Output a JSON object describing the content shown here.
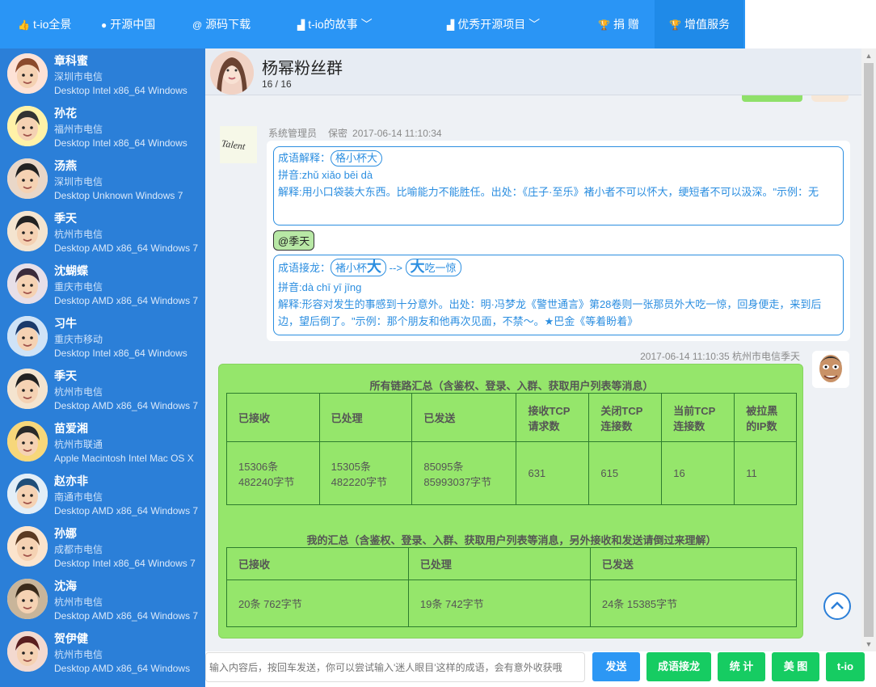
{
  "nav": {
    "items": [
      {
        "icon": "thumb-icon",
        "label": "t-io全景"
      },
      {
        "icon": "github-icon",
        "label": "开源中国"
      },
      {
        "icon": "at-icon",
        "label": "源码下载"
      },
      {
        "icon": "bar-chart-icon",
        "label": "t-io的故事"
      },
      {
        "icon": "bar-chart-icon",
        "label": "优秀开源项目"
      },
      {
        "icon": "trophy-icon",
        "label": "捐 赠"
      },
      {
        "icon": "trophy-icon",
        "label": "增值服务"
      }
    ]
  },
  "users": [
    {
      "name": "章科蜜",
      "loc": "深圳市电信",
      "device": "Desktop Intel x86_64 Windows"
    },
    {
      "name": "孙花",
      "loc": "福州市电信",
      "device": "Desktop Intel x86_64 Windows"
    },
    {
      "name": "汤燕",
      "loc": "深圳市电信",
      "device": "Desktop Unknown Windows 7"
    },
    {
      "name": "季天",
      "loc": "杭州市电信",
      "device": "Desktop AMD x86_64 Windows 7"
    },
    {
      "name": "沈蝴蝶",
      "loc": "重庆市电信",
      "device": "Desktop AMD x86_64 Windows 7"
    },
    {
      "name": "习牛",
      "loc": "重庆市移动",
      "device": "Desktop Intel x86_64 Windows"
    },
    {
      "name": "季天",
      "loc": "杭州市电信",
      "device": "Desktop AMD x86_64 Windows 7"
    },
    {
      "name": "苗爱湘",
      "loc": "杭州市联通",
      "device": "Apple Macintosh Intel Mac OS X"
    },
    {
      "name": "赵亦非",
      "loc": "南通市电信",
      "device": "Desktop AMD x86_64 Windows 7"
    },
    {
      "name": "孙娜",
      "loc": "成都市电信",
      "device": "Desktop Intel x86_64 Windows 7"
    },
    {
      "name": "沈海",
      "loc": "杭州市电信",
      "device": "Desktop AMD x86_64 Windows 7"
    },
    {
      "name": "贺伊健",
      "loc": "杭州市电信",
      "device": "Desktop AMD x86_64 Windows"
    }
  ],
  "chat": {
    "group_name": "杨幂粉丝群",
    "member_count": "16 / 16"
  },
  "sys_msg": {
    "avatar_text": "Talent",
    "sender": "系统管理员",
    "privacy": "保密",
    "time": "2017-06-14 11:10:34",
    "idiom1": {
      "label": "成语解释：",
      "word": "格小杯大",
      "pinyin": "拼音:zhǔ xiǎo bēi dà",
      "explain": "解释:用小口袋装大东西。比喻能力不能胜任。出处：《庄子·至乐》褚小者不可以怀大，绠短者不可以汲深。\"示例：无"
    },
    "mention": "@季天",
    "idiom2": {
      "label": "成语接龙：",
      "word_a": "褚小杯",
      "word_a_big": "大",
      "arrow": "-->",
      "word_b_big": "大",
      "word_b": "吃一惊",
      "pinyin": "拼音:dà chī yī jīng",
      "explain": "解释:形容对发生的事感到十分意外。出处：明·冯梦龙《警世通言》第28卷则一张那员外大吃一惊，回身便走，来到后边，望后倒了。\"示例：那个朋友和他再次见面，不禁～。★巴金《等着盼着》"
    }
  },
  "my_msg": {
    "time_loc": "2017-06-14 11:10:35 杭州市电信季天",
    "table1_title": "所有链路汇总（含鉴权、登录、入群、获取用户列表等消息）",
    "table1_headers": [
      "已接收",
      "已处理",
      "已发送",
      "接收TCP请求数",
      "关闭TCP连接数",
      "当前TCP连接数",
      "被拉黑的IP数"
    ],
    "table1_values": [
      "15306条 482240字节",
      "15305条 482220字节",
      "85095条 85993037字节",
      "631",
      "615",
      "16",
      "11"
    ],
    "table2_title": "我的汇总（含鉴权、登录、入群、获取用户列表等消息，另外接收和发送请倒过来理解）",
    "table2_headers": [
      "已接收",
      "已处理",
      "已发送"
    ],
    "table2_values": [
      "20条 762字节",
      "19条 742字节",
      "24条 15385字节"
    ]
  },
  "input": {
    "placeholder": "输入内容后，按回车发送，你可以尝试输入'迷人眼目'这样的成语，会有意外收获哦"
  },
  "buttons": {
    "send": "发送",
    "idiom_chain": "成语接龙",
    "stats": "统 计",
    "beauty": "美 图",
    "tio": "t-io"
  },
  "colors": {
    "nav": "#2a95f5",
    "sidebar": "#2b7fd8",
    "stats_bg": "#95e66b",
    "idiom_border": "#2b8ee0",
    "btn_green": "#16cc62"
  }
}
